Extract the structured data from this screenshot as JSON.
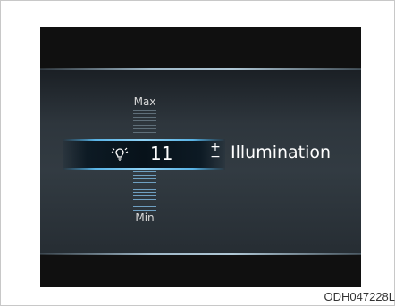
{
  "display": {
    "max_label": "Max",
    "min_label": "Min",
    "value": "11",
    "plus_label": "+",
    "minus_label": "−",
    "setting_title": "Illumination",
    "icon": "bulb-icon",
    "level": "11",
    "accent_color": "#5ab4e6"
  },
  "caption": "ODH047228L"
}
